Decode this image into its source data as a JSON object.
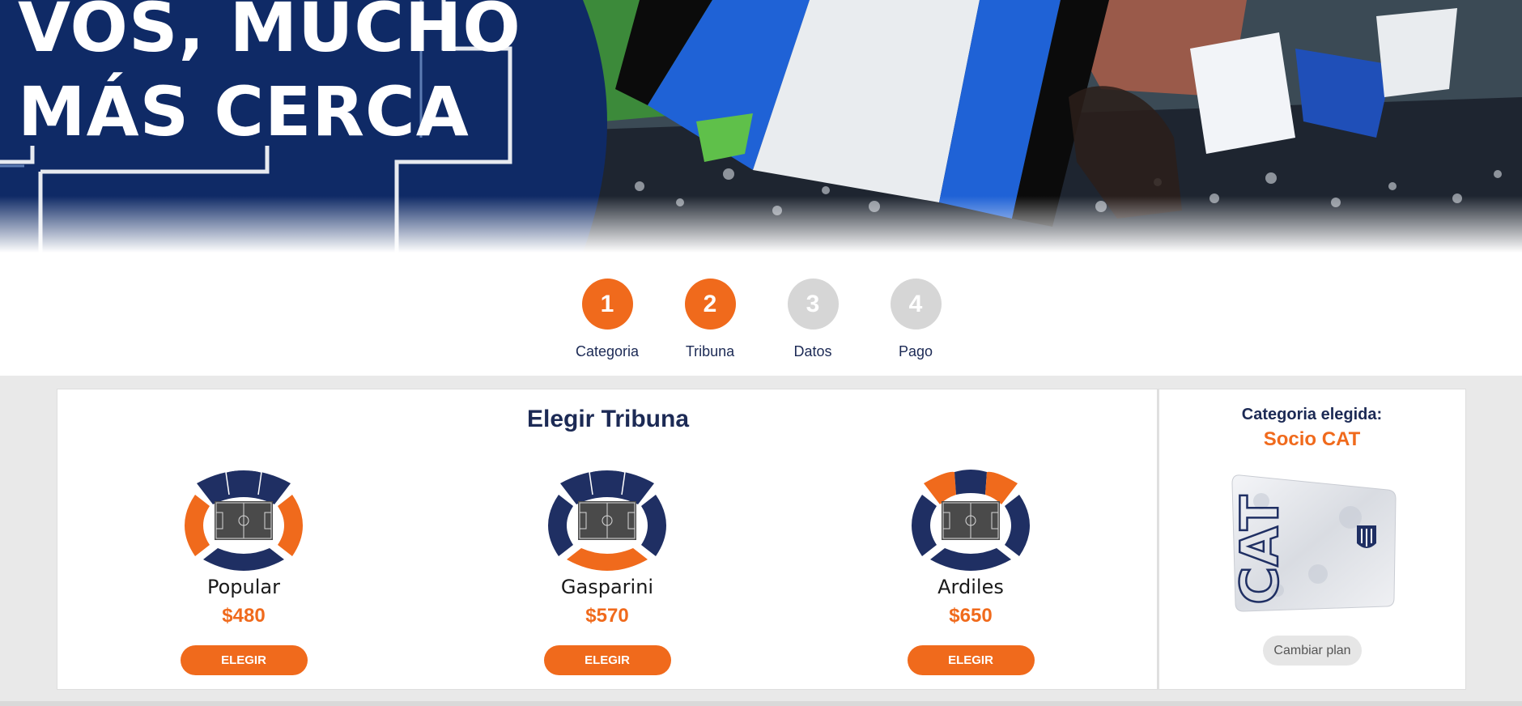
{
  "hero": {
    "title_line1": "VOS, MUCHO",
    "title_line2": "MÁS CERCA"
  },
  "stepper": {
    "steps": [
      {
        "number": "1",
        "label": "Categoria",
        "state": "completed"
      },
      {
        "number": "2",
        "label": "Tribuna",
        "state": "active"
      },
      {
        "number": "3",
        "label": "Datos",
        "state": "pending"
      },
      {
        "number": "4",
        "label": "Pago",
        "state": "pending"
      }
    ]
  },
  "main": {
    "title": "Elegir Tribuna",
    "options": [
      {
        "name": "Popular",
        "price": "$480",
        "button": "ELEGIR",
        "highlighted_sections": [
          "left",
          "right"
        ]
      },
      {
        "name": "Gasparini",
        "price": "$570",
        "button": "ELEGIR",
        "highlighted_sections": [
          "bottom"
        ]
      },
      {
        "name": "Ardiles",
        "price": "$650",
        "button": "ELEGIR",
        "highlighted_sections": [
          "top-left",
          "top-right"
        ]
      }
    ]
  },
  "sidebar": {
    "label": "Categoria elegida:",
    "category": "Socio CAT",
    "card_text": "CAT",
    "change_button": "Cambiar plan"
  },
  "colors": {
    "brand_orange": "#f06a1c",
    "brand_navy": "#1f2f63",
    "step_inactive": "#d6d6d6"
  }
}
